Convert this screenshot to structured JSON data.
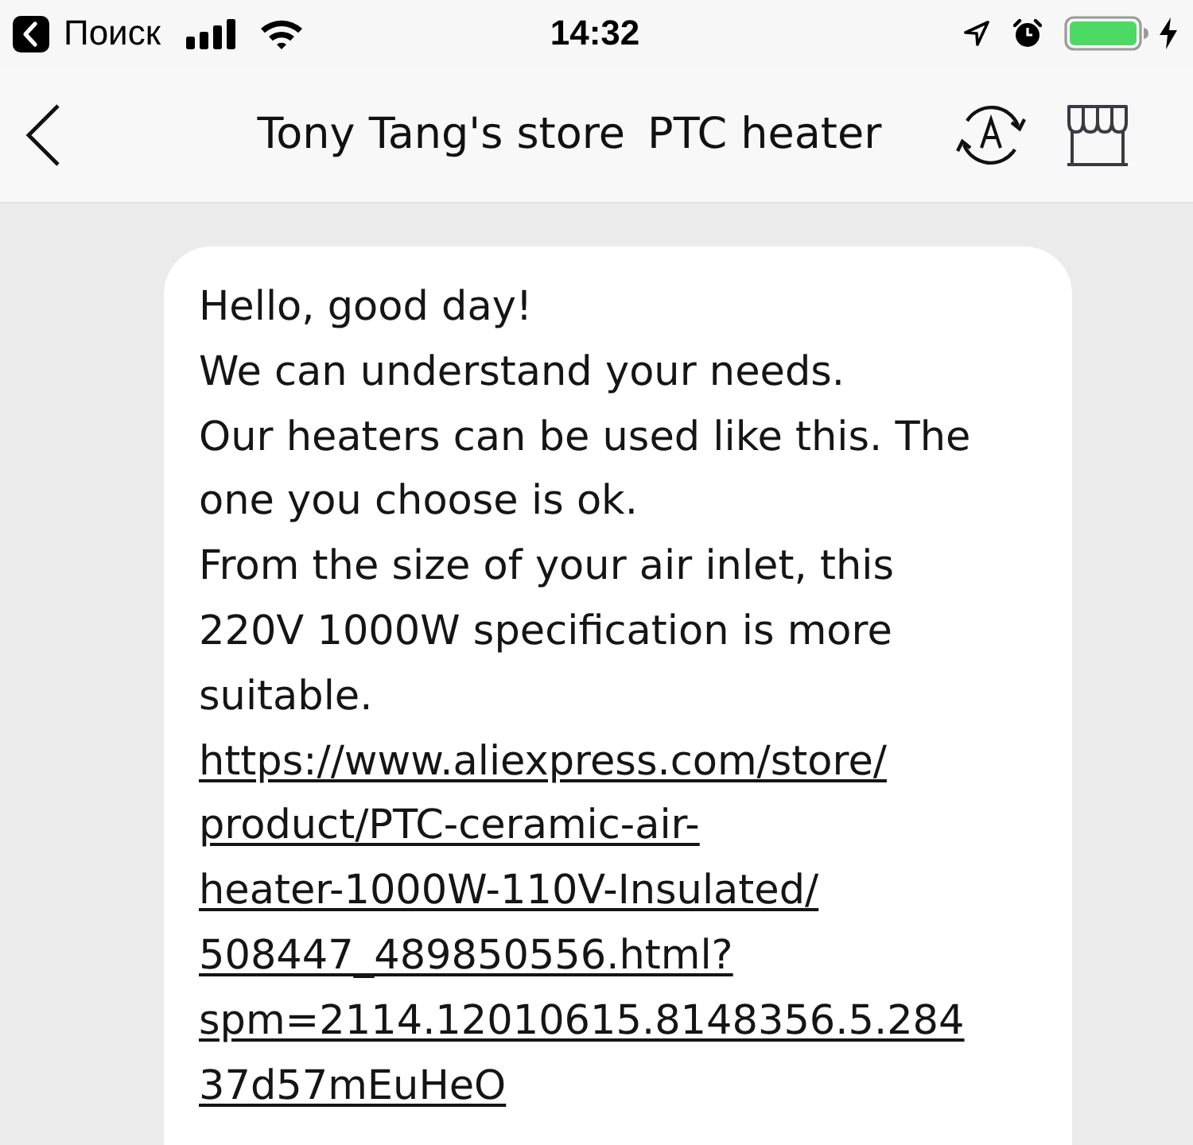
{
  "status_bar": {
    "back_label": "Поиск",
    "time": "14:32"
  },
  "header": {
    "store_name": "Tony Tang's store",
    "subject": "PTC heater"
  },
  "messages": [
    {
      "kind": "received",
      "paragraphs": [
        [
          "Hello, good day!"
        ],
        [
          "We can understand your needs."
        ],
        [
          "Our heaters can be used like this. The",
          "one you choose is ok."
        ],
        [
          "From the size of your air inlet, this",
          "220V 1000W specification is more",
          "suitable."
        ]
      ],
      "link": [
        "https://www.aliexpress.com/store/",
        "product/PTC-ceramic-air-",
        "heater-1000W-110V-Insulated/",
        "508447_489850556.html?",
        "spm=2114.12010615.8148356.5.284",
        "37d57mEuHeO"
      ]
    }
  ]
}
